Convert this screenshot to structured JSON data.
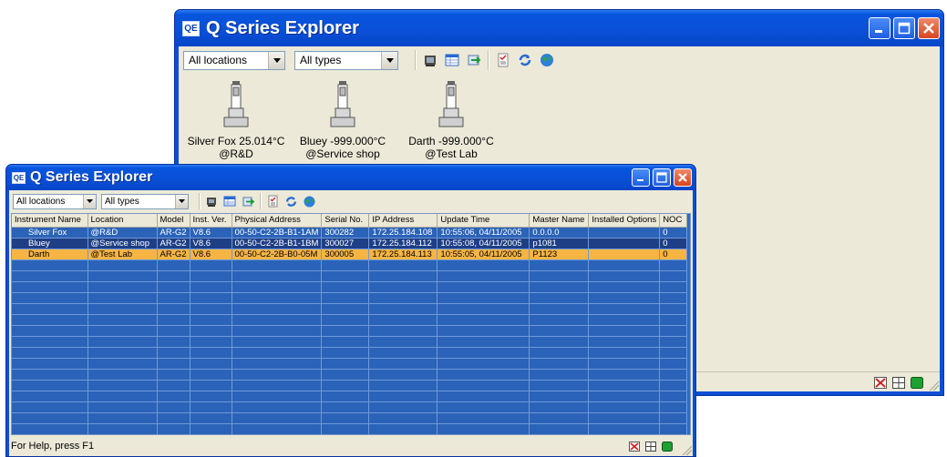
{
  "app_title": "Q Series Explorer",
  "app_icon": "QE",
  "toolbar": {
    "location_filter": "All locations",
    "type_filter": "All types",
    "icons": [
      "device-view-icon",
      "table-view-icon",
      "export-icon",
      "checklist-icon",
      "refresh-icon",
      "globe-icon"
    ]
  },
  "devices": [
    {
      "name_temp": "Silver Fox  25.014°C",
      "location": "@R&D"
    },
    {
      "name_temp": "Bluey -999.000°C",
      "location": "@Service shop"
    },
    {
      "name_temp": "Darth -999.000°C",
      "location": "@Test Lab"
    }
  ],
  "table": {
    "columns": [
      "Instrument Name",
      "Location",
      "Model",
      "Inst. Ver.",
      "Physical Address",
      "Serial No.",
      "IP Address",
      "Update Time",
      "Master Name",
      "Installed Options",
      "NOC"
    ],
    "rows": [
      [
        "Silver Fox",
        "@R&D",
        "AR-G2",
        "V8.6",
        "00-50-C2-2B-B1-1AM",
        "300282",
        "172.25.184.108",
        "10:55:06, 04/11/2005",
        "0.0.0.0",
        "",
        "0"
      ],
      [
        "Bluey",
        "@Service shop",
        "AR-G2",
        "V8.6",
        "00-50-C2-2B-B1-1BM",
        "300027",
        "172.25.184.112",
        "10:55:08, 04/11/2005",
        "p1081",
        "",
        "0"
      ],
      [
        "Darth",
        "@Test Lab",
        "AR-G2",
        "V8.6",
        "00-50-C2-2B-B0-05M",
        "300005",
        "172.25.184.113",
        "10:55:05, 04/11/2005",
        "P1123",
        "",
        "0"
      ]
    ],
    "selected_row": 2,
    "empty_rows": 19
  },
  "status": {
    "text": "For Help, press F1",
    "icons": [
      "network-error-icon",
      "grid-icon",
      "connected-icon"
    ]
  },
  "colors": {
    "title_bar": "#0a4fd6",
    "grid_bg": "#2f6bc3",
    "selected_row": "#f6b443",
    "close_button": "#d6451f"
  }
}
